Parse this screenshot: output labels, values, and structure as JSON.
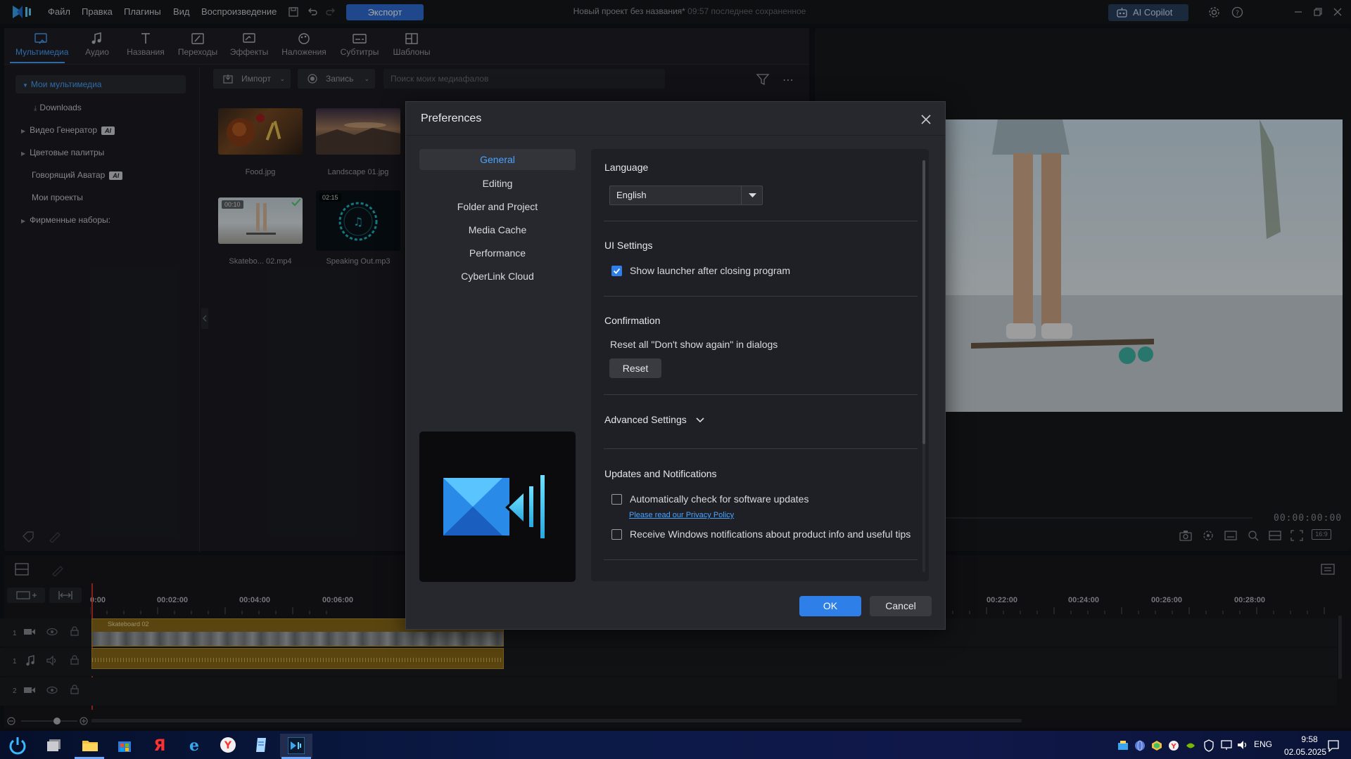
{
  "app": {
    "menu": [
      "Файл",
      "Правка",
      "Плагины",
      "Вид",
      "Воспроизведение"
    ],
    "export_label": "Экспорт",
    "project_name": "Новый проект без названия*",
    "last_saved": "09:57 последнее сохраненное",
    "ai_copilot_label": "AI Copilot"
  },
  "room_tabs": [
    {
      "label": "Мультимедиа",
      "icon": "media-icon",
      "active": true
    },
    {
      "label": "Аудио",
      "icon": "music-icon"
    },
    {
      "label": "Названия",
      "icon": "title-icon"
    },
    {
      "label": "Переходы",
      "icon": "transition-icon"
    },
    {
      "label": "Эффекты",
      "icon": "effects-icon"
    },
    {
      "label": "Наложения",
      "icon": "overlay-icon"
    },
    {
      "label": "Субтитры",
      "icon": "subtitle-icon"
    },
    {
      "label": "Шаблоны",
      "icon": "template-icon"
    }
  ],
  "sidebar": {
    "items": [
      {
        "label": "Мои мультимедиа",
        "selected": true
      },
      {
        "label": "Downloads"
      },
      {
        "label": "Видео Генератор",
        "badge": "AI"
      },
      {
        "label": "Цветовые палитры"
      },
      {
        "label": "Говорящий Аватар",
        "badge": "AI"
      },
      {
        "label": "Мои проекты"
      },
      {
        "label": "Фирменные наборы:"
      }
    ]
  },
  "media_toolbar": {
    "import_label": "Импорт",
    "record_label": "Запись",
    "search_placeholder": "Поиск моих медиафалов"
  },
  "media_items": [
    {
      "name": "Food.jpg"
    },
    {
      "name": "Landscape 01.jpg"
    },
    {
      "name": "Skatebo... 02.mp4",
      "duration": "00:10"
    },
    {
      "name": "Speaking Out.mp3",
      "duration": "02:15"
    }
  ],
  "preview": {
    "timecode": "00:00:00:00",
    "aspect": "16:9"
  },
  "timeline": {
    "ruler_left": [
      "0:00",
      "00:02:00",
      "00:04:00",
      "00:06:00"
    ],
    "ruler_right": [
      "00:22:00",
      "00:24:00",
      "00:26:00",
      "00:28:00"
    ],
    "clip_name": "Skateboard 02",
    "tracks": [
      "1",
      "1",
      "2"
    ]
  },
  "dialog": {
    "title": "Preferences",
    "categories": [
      "General",
      "Editing",
      "Folder and Project",
      "Media Cache",
      "Performance",
      "CyberLink Cloud"
    ],
    "language_title": "Language",
    "language_value": "English",
    "ui_title": "UI Settings",
    "ui_launcher": "Show launcher after closing program",
    "ui_launcher_checked": true,
    "confirm_title": "Confirmation",
    "confirm_text": "Reset all \"Don't show again\" in dialogs",
    "reset_label": "Reset",
    "advanced_title": "Advanced Settings",
    "updates_title": "Updates and Notifications",
    "auto_update": "Automatically check for software updates",
    "privacy_link": "Please read our Privacy Policy",
    "win_notify": "Receive Windows notifications about product info and useful tips",
    "ok_label": "OK",
    "cancel_label": "Cancel"
  },
  "taskbar": {
    "lang": "ENG",
    "time": "9:58",
    "date": "02.05.2025"
  },
  "colors": {
    "accent": "#2f7fe8",
    "background": "#121317",
    "dialog": "#27282d"
  }
}
